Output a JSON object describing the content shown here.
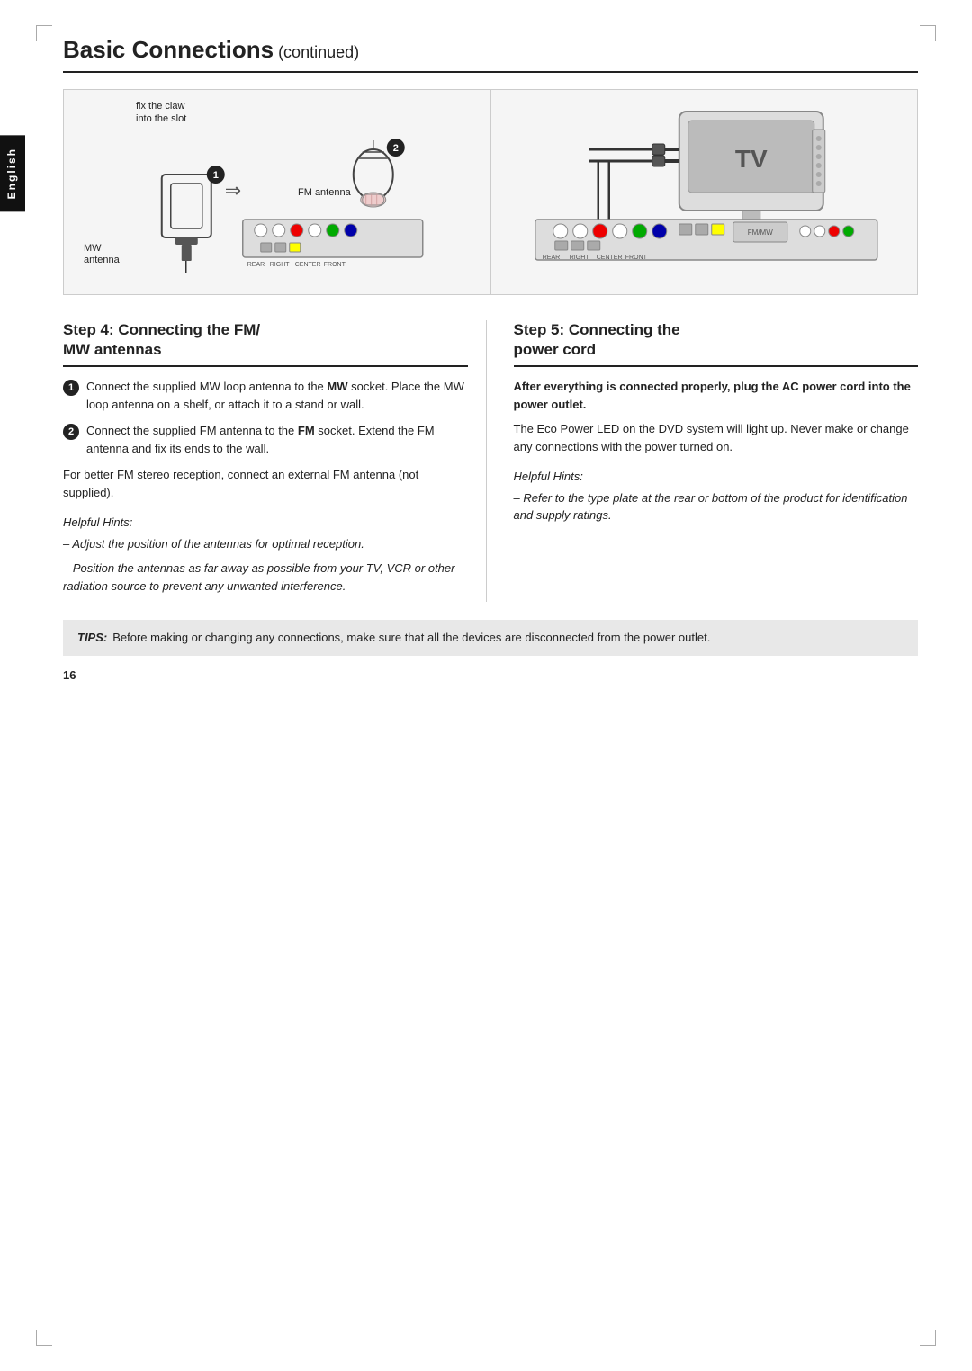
{
  "page": {
    "title": "Basic Connections",
    "title_continued": " (continued)",
    "page_number": "16"
  },
  "english_tab": "English",
  "diagram": {
    "left": {
      "labels": {
        "fix_claw": "fix the claw",
        "into_slot": "into the slot",
        "fm_antenna": "FM antenna",
        "mw_antenna": "MW",
        "mw_antenna2": "antenna"
      }
    },
    "right": {
      "tv_label": "TV"
    }
  },
  "step4": {
    "number": "4",
    "title": "Step 4:  Connecting the FM/\nMW antennas",
    "title_line1": "Step 4:  Connecting the FM/",
    "title_line2": "MW antennas",
    "items": [
      {
        "num": "1",
        "text": "Connect the supplied MW loop antenna to the ",
        "bold": "MW",
        "text2": " socket.  Place the MW loop antenna on a shelf, or attach it to a stand or wall."
      },
      {
        "num": "2",
        "text": "Connect the supplied FM antenna to the ",
        "bold": "FM",
        "text2": " socket.  Extend the FM antenna and fix its ends to the wall."
      }
    ],
    "extra_para": "For better FM stereo reception, connect an external FM antenna (not supplied).",
    "helpful_hints": {
      "title": "Helpful Hints:",
      "lines": [
        "– Adjust the position of the antennas for optimal reception.",
        "– Position the antennas as far away as possible from your TV, VCR or other radiation source to prevent any unwanted interference."
      ]
    }
  },
  "step5": {
    "number": "5",
    "title_line1": "Step 5:  Connecting the",
    "title_line2": "power cord",
    "bold_para": "After everything is connected properly, plug the AC power cord into the power outlet.",
    "body_para": "The Eco Power LED on the DVD system will light up. Never make or change any connections with the power turned on.",
    "helpful_hints": {
      "title": "Helpful Hints:",
      "lines": [
        "– Refer to the type plate at the rear or bottom of the product for identification and supply ratings."
      ]
    }
  },
  "tips": {
    "label": "TIPS:",
    "text": "Before making or changing any connections, make sure that all the devices are disconnected from the power outlet."
  }
}
